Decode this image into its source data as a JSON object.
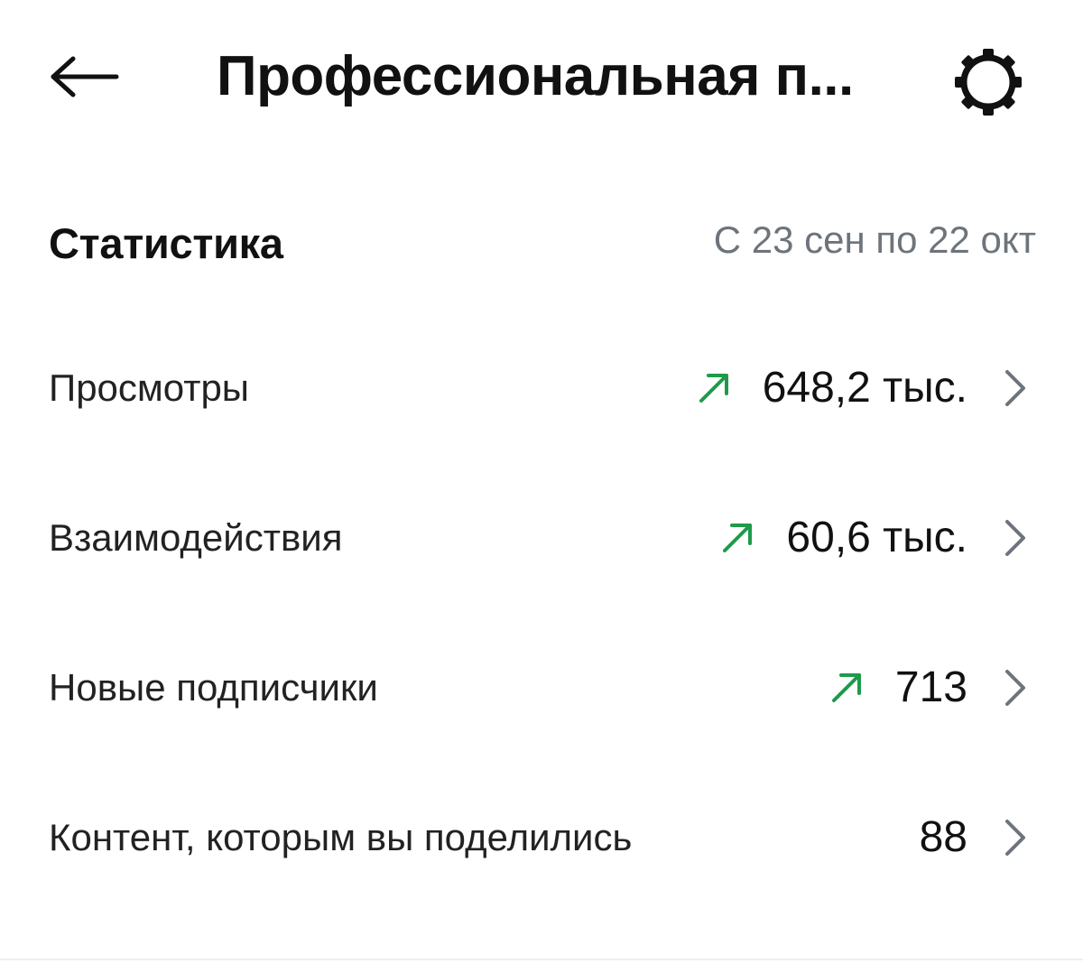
{
  "header": {
    "back_icon": "arrow-left-icon",
    "title": "Профессиональная п...",
    "settings_icon": "gear-icon"
  },
  "stats": {
    "title": "Статистика",
    "date_range": "С 23 сен по 22 окт",
    "trend_color": "#1e9a4a",
    "rows": [
      {
        "label": "Просмотры",
        "value": "648,2 тыс.",
        "trend": "up"
      },
      {
        "label": "Взаимодействия",
        "value": "60,6 тыс.",
        "trend": "up"
      },
      {
        "label": "Новые подписчики",
        "value": "713",
        "trend": "up"
      },
      {
        "label": "Контент, которым вы поделились",
        "value": "88",
        "trend": "none"
      }
    ]
  }
}
